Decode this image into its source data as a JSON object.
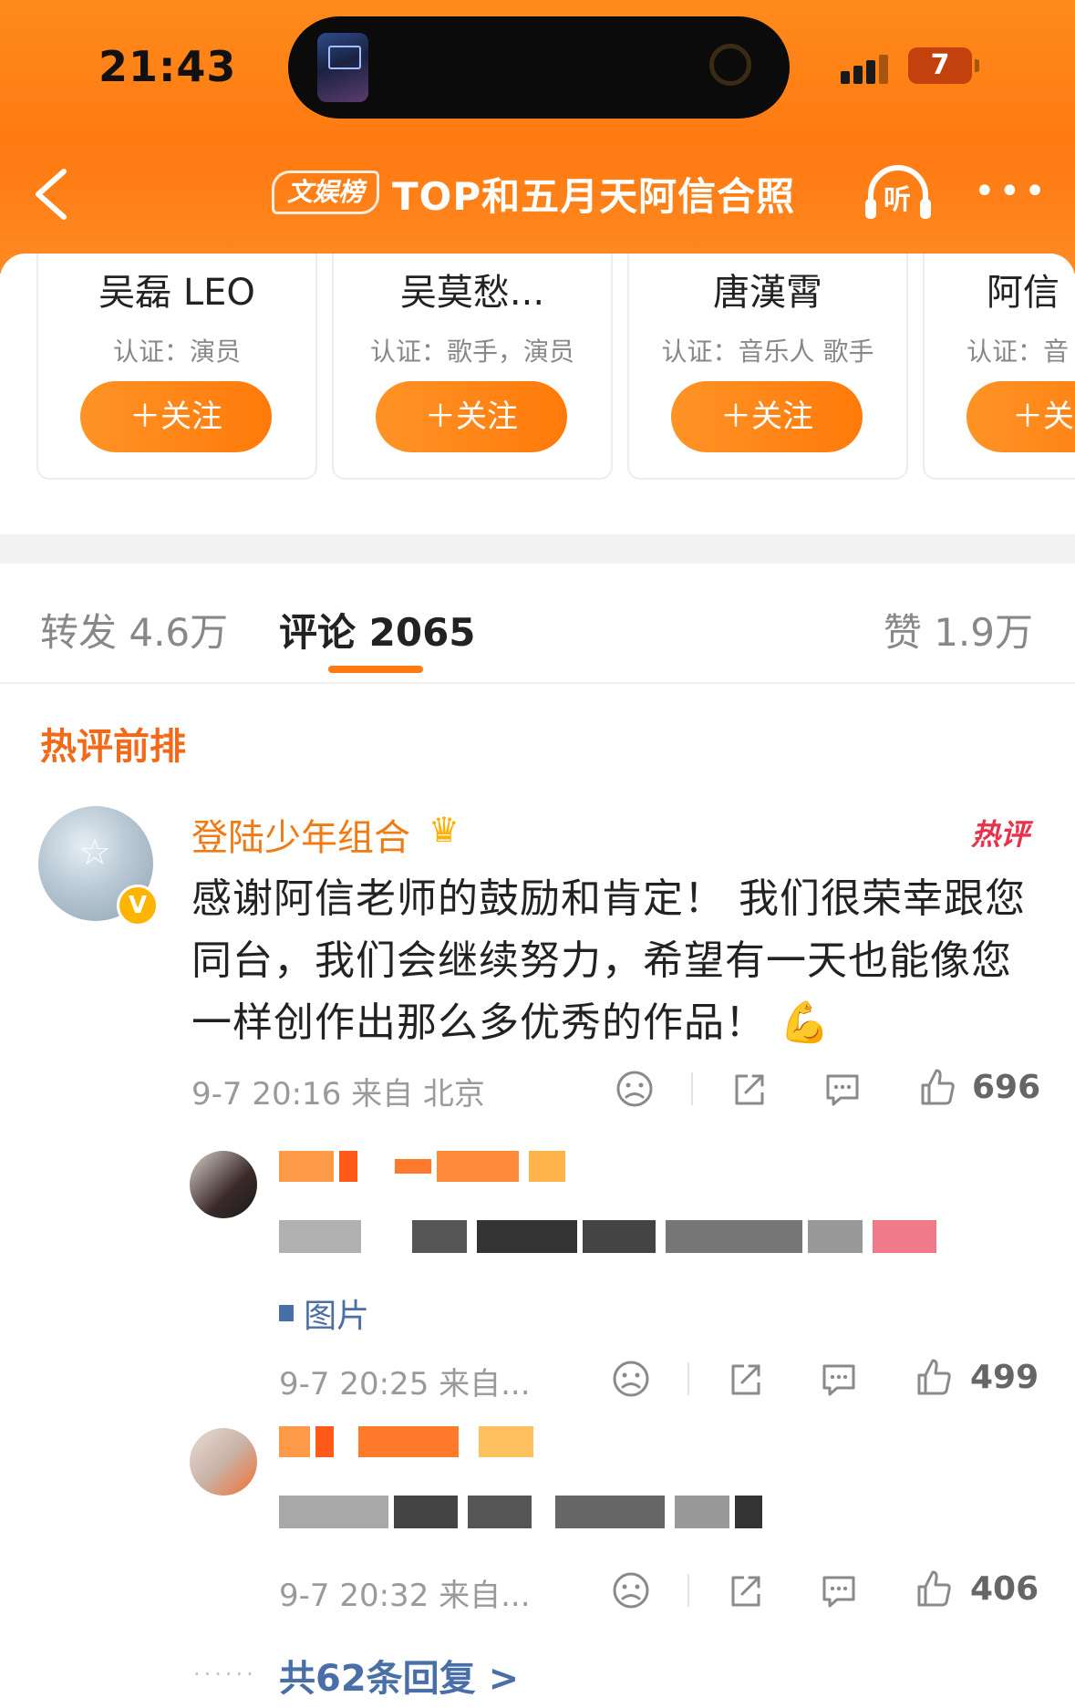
{
  "status_bar": {
    "time": "21:43",
    "battery": "7"
  },
  "nav": {
    "badge": "文娱榜",
    "title": "TOP和五月天阿信合照",
    "listen_label": "听",
    "more_label": "•••"
  },
  "cards": [
    {
      "name": "吴磊 LEO",
      "verify": "认证：演员",
      "follow": "＋关注"
    },
    {
      "name": "吴莫愁...",
      "verify": "认证：歌手，演员",
      "follow": "＋关注"
    },
    {
      "name": "唐漢霄",
      "verify": "认证：音乐人 歌手",
      "follow": "＋关注"
    },
    {
      "name": "阿信",
      "verify": "认证：音",
      "follow": "＋关"
    }
  ],
  "tabs": {
    "repost": "转发 4.6万",
    "comment": "评论 2065",
    "like": "赞 1.9万"
  },
  "section_title": "热评前排",
  "comment": {
    "user": "登陆少年组合",
    "hot_badge": "热评",
    "text": "感谢阿信老师的鼓励和肯定！ 我们很荣幸跟您同台，我们会继续努力，希望有一天也能像您一样创作出那么多优秀的作品！",
    "emoji": "💪",
    "meta": "9-7 20:16 来自 北京",
    "likes": "696"
  },
  "replies": [
    {
      "image_label": "图片",
      "meta": "9-7 20:25 来自...",
      "likes": "499"
    },
    {
      "meta": "9-7 20:32 来自...",
      "likes": "406"
    }
  ],
  "more_replies": "共62条回复 >",
  "colors": {
    "brand_orange": "#ff7a12",
    "link_blue": "#4a6ea8",
    "hot_red": "#e8314a"
  }
}
